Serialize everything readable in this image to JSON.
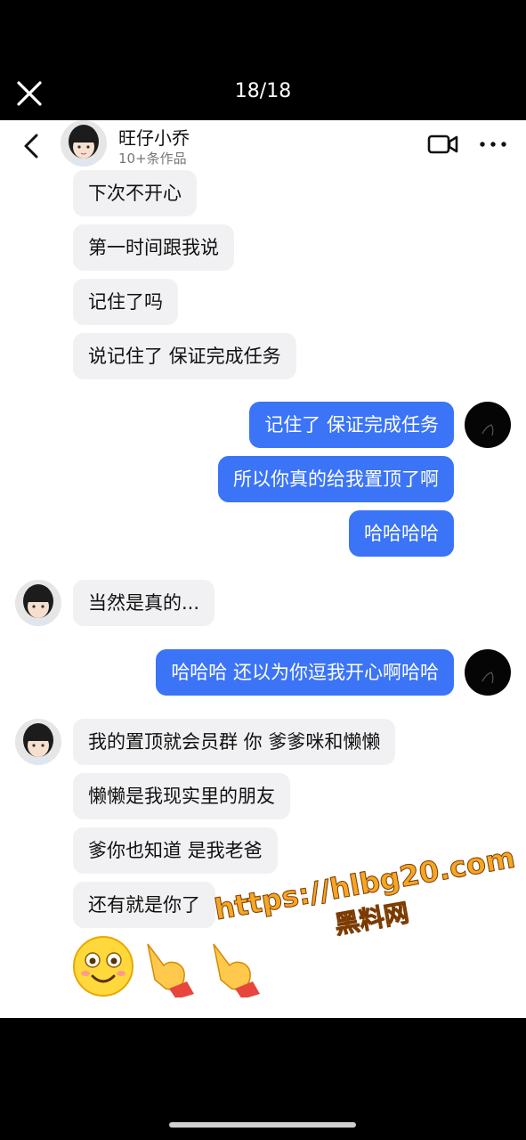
{
  "viewer": {
    "counter": "18/18"
  },
  "header": {
    "name": "旺仔小乔",
    "subtitle": "10+条作品"
  },
  "messages": [
    {
      "side": "in",
      "text": "下次不开心"
    },
    {
      "side": "in",
      "text": "第一时间跟我说"
    },
    {
      "side": "in",
      "text": "记住了吗"
    },
    {
      "side": "in",
      "text": "说记住了 保证完成任务"
    },
    {
      "side": "out",
      "text": "记住了 保证完成任务"
    },
    {
      "side": "out",
      "text": "所以你真的给我置顶了啊"
    },
    {
      "side": "out",
      "text": "哈哈哈哈"
    },
    {
      "side": "in",
      "text": "当然是真的..."
    },
    {
      "side": "out",
      "text": "哈哈哈 还以为你逗我开心啊哈哈"
    },
    {
      "side": "in",
      "text": "我的置顶就会员群 你 爹爹咪和懒懒"
    },
    {
      "side": "in",
      "text": "懒懒是我现实里的朋友"
    },
    {
      "side": "in",
      "text": "爹你也知道 是我老爸"
    },
    {
      "side": "in",
      "text": "还有就是你了"
    }
  ],
  "emojis": [
    "smiling-face-emoji",
    "pointing-hand-emoji",
    "pointing-hand-emoji"
  ],
  "watermark": {
    "url": "https://hlbg20.com",
    "label": "黑料网"
  },
  "colors": {
    "outgoing": "#3b74f7",
    "incoming": "#f1f1f3",
    "watermark": "#f5a623"
  }
}
